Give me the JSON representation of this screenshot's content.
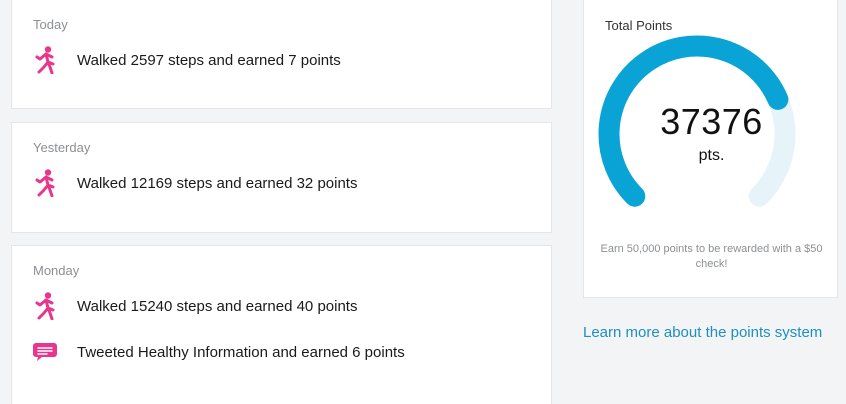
{
  "feed": {
    "days": [
      {
        "label": "Today",
        "activities": [
          {
            "icon": "walking-person-icon",
            "text": "Walked 2597 steps and earned 7 points"
          }
        ]
      },
      {
        "label": "Yesterday",
        "activities": [
          {
            "icon": "walking-person-icon",
            "text": "Walked 12169 steps and earned 32 points"
          }
        ]
      },
      {
        "label": "Monday",
        "activities": [
          {
            "icon": "walking-person-icon",
            "text": "Walked 15240 steps and earned 40 points"
          },
          {
            "icon": "speech-bubble-icon",
            "text": "Tweeted Healthy Information and earned 6 points"
          }
        ]
      }
    ]
  },
  "points": {
    "title": "Total Points",
    "value": "37376",
    "unit": "pts.",
    "goal": 50000,
    "progress_fraction": 0.7475,
    "note": "Earn 50,000 points to be rewarded with a $50 check!"
  },
  "learn_more": {
    "label": "Learn more about the points system"
  },
  "colors": {
    "accent": "#0aa3d6",
    "track": "#e6f4fa",
    "icon_pink": "#e8368f",
    "link": "#1e8fbf",
    "muted_text": "#8c8f92"
  }
}
